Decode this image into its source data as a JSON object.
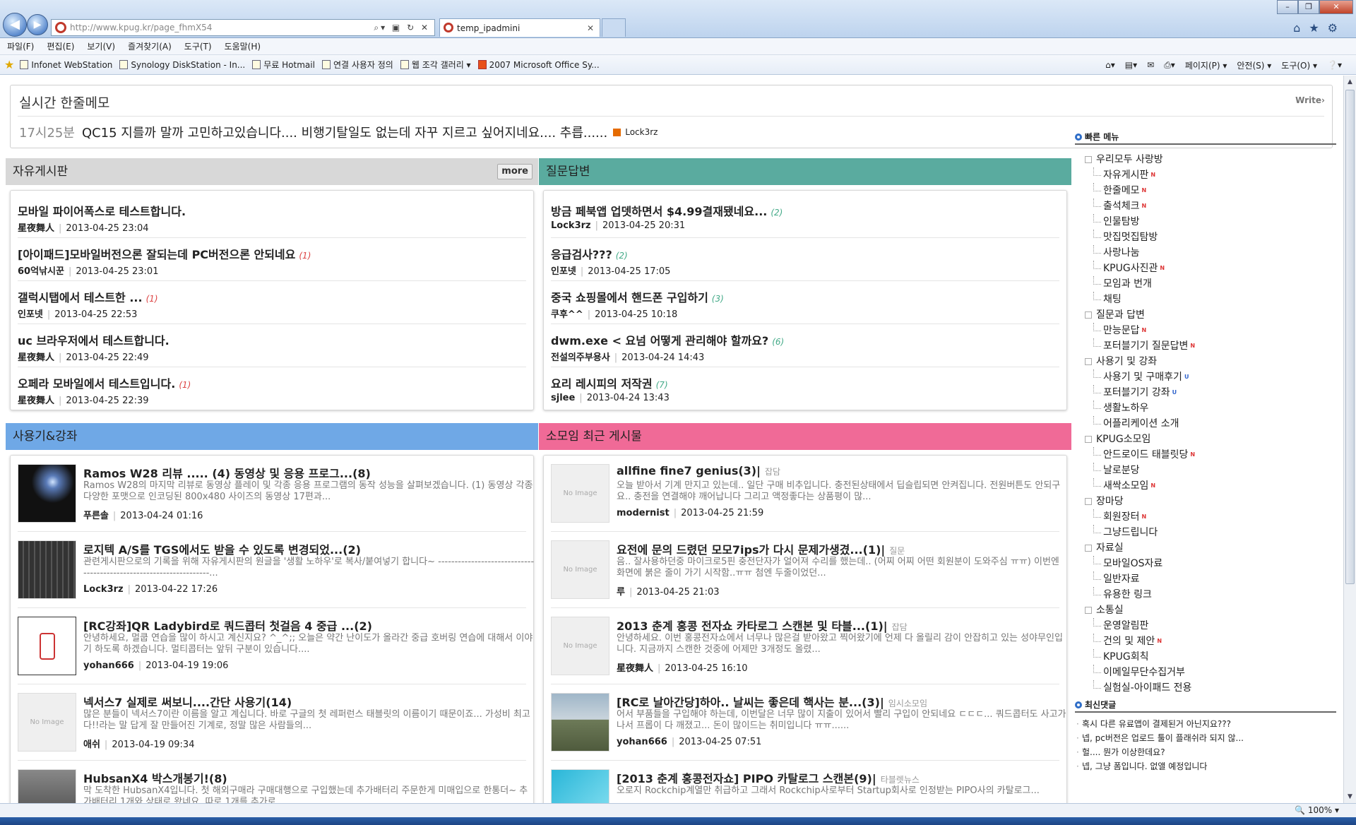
{
  "browser": {
    "url": "http://www.kpug.kr/page_fhmX54",
    "tab_title": "temp_ipadmini",
    "zoom": "100%",
    "menu": [
      "파일(F)",
      "편집(E)",
      "보기(V)",
      "즐겨찾기(A)",
      "도구(T)",
      "도움말(H)"
    ],
    "favorites": [
      "Infonet WebStation",
      "Synology DiskStation - In...",
      "무료 Hotmail",
      "연결 사용자 정의",
      "웹 조각 갤러리 ▾",
      "2007 Microsoft Office Sy..."
    ],
    "commands": [
      "페이지(P) ▾",
      "안전(S) ▾",
      "도구(O) ▾"
    ]
  },
  "memo": {
    "title": "실시간 한줄메모",
    "write_label": "Write›",
    "time": "17시25분",
    "text": "QC15 지를까 말까 고민하고있습니다.... 비행기탈일도 없는데 자꾸 지르고 싶어지네요.... 추릅......",
    "user": "Lock3rz"
  },
  "free_board": {
    "title": "자유게시판",
    "more_label": "more",
    "posts": [
      {
        "title": "모바일 파이어폭스로 테스트합니다.",
        "count": "",
        "author": "星夜舞人",
        "date": "2013-04-25 23:04"
      },
      {
        "title": "[아이패드]모바일버전으론 잘되는데 PC버전으론 안되네요",
        "count": "(1)",
        "author": "60억낚시꾼",
        "date": "2013-04-25 23:01"
      },
      {
        "title": "갤럭시탭에서 테스트한 ...",
        "count": "(1)",
        "author": "인포넷",
        "date": "2013-04-25 22:53"
      },
      {
        "title": "uc 브라우저에서 테스트합니다.",
        "count": "",
        "author": "星夜舞人",
        "date": "2013-04-25 22:49"
      },
      {
        "title": "오페라 모바일에서 테스트입니다.",
        "count": "(1)",
        "author": "星夜舞人",
        "date": "2013-04-25 22:39"
      }
    ]
  },
  "qna_board": {
    "title": "질문답변",
    "posts": [
      {
        "title": "방금 페북앱 업뎃하면서 $4.99결재됐네요...",
        "count": "(2)",
        "author": "Lock3rz",
        "date": "2013-04-25 20:31"
      },
      {
        "title": "응급검사???",
        "count": "(2)",
        "author": "인포넷",
        "date": "2013-04-25 17:05"
      },
      {
        "title": "중국 쇼핑몰에서 핸드폰 구입하기",
        "count": "(3)",
        "author": "쿠후^^",
        "date": "2013-04-25 10:18"
      },
      {
        "title": "dwm.exe < 요넘 어떻게 관리해야 할까요?",
        "count": "(6)",
        "author": "전설의주부용사",
        "date": "2013-04-24 14:43"
      },
      {
        "title": "요리 레시피의 저작권",
        "count": "(7)",
        "author": "sjlee",
        "date": "2013-04-24 13:43"
      }
    ]
  },
  "review_board": {
    "title": "사용기&강좌",
    "posts": [
      {
        "title": "Ramos W28 리뷰 ..... (4) 동영상 및 응용 프로그...",
        "count": "(8)",
        "desc": "Ramos W28의 마지막 리뷰로 동영상 플레이 및 각종 응용 프로그램의 동작 성능을 살펴보겠습니다.  (1) 동영상 각종 다양한 포맷으로 인코딩된 800x480 사이즈의 동영상 17편과...",
        "author": "푸른솔",
        "date": "2013-04-24 01:16",
        "thumb": "concert"
      },
      {
        "title": "로지텍 A/S를 TGS에서도 받을 수 있도록 변경되었...",
        "count": "(2)",
        "desc": "관련게시판으로의 기록을 위해 자유게시판의 원글을 '생활 노하우'로 복사/붙여넣기 합니다~ -------------------------------------------------------------------...",
        "author": "Lock3rz",
        "date": "2013-04-22 17:26",
        "thumb": "keyboard"
      },
      {
        "title": "[RC강좌]QR Ladybird로 쿼드콥터 첫걸음 4 중급 ...",
        "count": "(2)",
        "desc": "안녕하세요, 멀쿱 연습을 많이 하시고 계신지요? ^_^;; 오늘은 약간 난이도가 올라간 중급 호버링 연습에 대해서 이야기 하도록 하겠습니다. 멀티콥터는 앞뒤 구분이 있습니다....",
        "author": "yohan666",
        "date": "2013-04-19 19:06",
        "thumb": "diagram"
      },
      {
        "title": "넥서스7 실제로 써보니....간단 사용기",
        "count": "(14)",
        "desc": "많은 분들이 넥서스7이란 이름을 알고 계십니다. 바로 구글의 첫 레퍼런스 태블릿의 이름이기 때문이죠... 가성비 최고다!!라는 말 답게 잘 만들어진 기계로, 정말 많은 사람들의...",
        "author": "애쉬",
        "date": "2013-04-19 09:34",
        "thumb": "none"
      },
      {
        "title": "HubsanX4 박스개봉기!",
        "count": "(8)",
        "desc": "막 도착한 HubsanX4입니다. 첫 해외구매라 구매대행으로 구입했는데 추가배터리 주문한게 미매입으로 한통더~ 추가배터리 1개와 상태로 왔네요. 따로 1개를 추가로...",
        "author": "",
        "date": "",
        "thumb": "box"
      }
    ]
  },
  "club_board": {
    "title": "소모임 최근 게시물",
    "posts": [
      {
        "title": "allfine fine7 genius",
        "count": "(3)",
        "cat": "잡담",
        "desc": "오늘 받아서 기계 만지고 있는데.. 일단 구매 비추입니다. 충전된상태에서 딥슬립되면 안켜집니다. 전원버튼도 안되구요.. 충전을 연결해야 깨어납니다 그리고 액정좋다는 상품평이 많...",
        "author": "modernist",
        "date": "2013-04-25 21:59",
        "thumb": "none"
      },
      {
        "title": "요전에 문의 드렸던 모모7ips가 다시 문제가생겼...",
        "count": "(1)",
        "cat": "질문",
        "desc": "음.. 잘사용하던중 마이크로5핀 충전단자가 얼어져 수리를 했는데.. (어찌 어찌 어떤 회원분이 도와주심 ㅠㅠ) 이번엔 화면에 붉은 줄이 가기 시작함..ㅠㅠ 첨엔 두줄이었던...",
        "author": "루",
        "date": "2013-04-25 21:03",
        "thumb": "none"
      },
      {
        "title": "2013 춘계 홍콩 전자쇼 카타로그 스캔본 및 타블...",
        "count": "(1)",
        "cat": "잡담",
        "desc": "안녕하세요.   이번 홍콩전자쇼에서 너무나 많은걸 받아왔고 찍어왔기에 언제 다 올릴리   감이 안잡히고 있는 성야무인입니다.   지금까지 스캔한 것중에 어제만 3개정도 올렸...",
        "author": "星夜舞人",
        "date": "2013-04-25 16:10",
        "thumb": "none"
      },
      {
        "title": "[RC로 날아간당]하아.. 날씨는 좋은데 핵사는 분...",
        "count": "(3)",
        "cat": "임시소모임",
        "desc": "어서 부품들을 구입해야 하는데, 이번달은 너무 많이 지출이 있어서 빨리 구입이 안되네요 ㄷㄷㄷ... 쿼드콥터도 사고가 나서 프롭이 다 깨졌고... 돈이 많이드는 취미입니다 ㅠㅠ......",
        "author": "yohan666",
        "date": "2013-04-25 07:51",
        "thumb": "drone"
      },
      {
        "title": "[2013 춘계 홍콩전자쇼] PIPO 카탈로그 스캔본",
        "count": "(9)",
        "cat": "타블렛뉴스",
        "desc": "오로지 Rockchip계열만 취급하고 그래서 Rockchip사로부터 Startup회사로 인정받는 PIPO사의 카탈로그...",
        "author": "",
        "date": "",
        "thumb": "catalog"
      }
    ]
  },
  "no_image_label": "No Image",
  "quick_menu": {
    "title": "빠른 메뉴",
    "groups": [
      {
        "label": "우리모두 사랑방",
        "items": [
          {
            "label": "자유게시판",
            "badge": "N"
          },
          {
            "label": "한줄메모",
            "badge": "N"
          },
          {
            "label": "출석체크",
            "badge": "N"
          },
          {
            "label": "인물탐방",
            "badge": ""
          },
          {
            "label": "맛집멋집탐방",
            "badge": ""
          },
          {
            "label": "사랑나눔",
            "badge": ""
          },
          {
            "label": "KPUG사진관",
            "badge": "N"
          },
          {
            "label": "모임과 번개",
            "badge": ""
          },
          {
            "label": "채팅",
            "badge": ""
          }
        ]
      },
      {
        "label": "질문과 답변",
        "items": [
          {
            "label": "만능문답",
            "badge": "N"
          },
          {
            "label": "포터블기기 질문답변",
            "badge": "N"
          }
        ]
      },
      {
        "label": "사용기 및 강좌",
        "items": [
          {
            "label": "사용기 및 구매후기",
            "badge": "U"
          },
          {
            "label": "포터블기기 강좌",
            "badge": "U"
          },
          {
            "label": "생활노하우",
            "badge": ""
          },
          {
            "label": "어플리케이션 소개",
            "badge": ""
          }
        ]
      },
      {
        "label": "KPUG소모임",
        "items": [
          {
            "label": "안드로이드 태블릿당",
            "badge": "N"
          },
          {
            "label": "날로분당",
            "badge": ""
          },
          {
            "label": "새싹소모임",
            "badge": "N"
          }
        ]
      },
      {
        "label": "장마당",
        "items": [
          {
            "label": "회원장터",
            "badge": "N"
          },
          {
            "label": "그냥드립니다",
            "badge": ""
          }
        ]
      },
      {
        "label": "자료실",
        "items": [
          {
            "label": "모바일OS자료",
            "badge": ""
          },
          {
            "label": "일반자료",
            "badge": ""
          },
          {
            "label": "유용한 링크",
            "badge": ""
          }
        ]
      },
      {
        "label": "소통실",
        "items": [
          {
            "label": "운영알림판",
            "badge": ""
          },
          {
            "label": "건의 및 제안",
            "badge": "N"
          },
          {
            "label": "KPUG회칙",
            "badge": ""
          },
          {
            "label": "이메일무단수집거부",
            "badge": ""
          },
          {
            "label": "실험실-아이패드 전용",
            "badge": ""
          }
        ]
      }
    ]
  },
  "recent_comments": {
    "title": "최신댓글",
    "items": [
      "혹시 다른 유료앱이 결제된거 아닌지요???",
      "넵, pc버전은 업로드 툴이 플래쉬라 되지 않...",
      "헐.... 뭔가 이상한데요?",
      "넵, 그냥 폼입니다. 없앨 예정입니다"
    ]
  },
  "colors": {
    "free": "#d8d8d8",
    "qna": "#5aab9f",
    "review": "#6fa8e6",
    "club": "#f06a97"
  }
}
